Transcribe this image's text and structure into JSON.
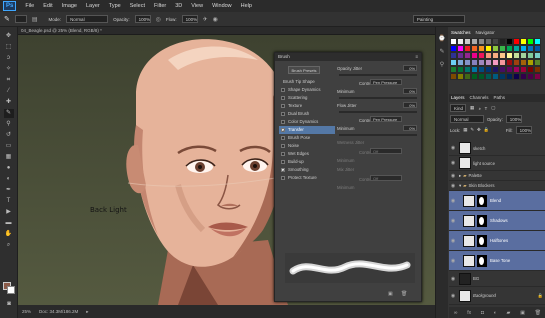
{
  "menubar": {
    "logo": "Ps",
    "items": [
      "File",
      "Edit",
      "Image",
      "Layer",
      "Type",
      "Select",
      "Filter",
      "3D",
      "View",
      "Window",
      "Help"
    ]
  },
  "options": {
    "mode_label": "Mode:",
    "mode_value": "Normal",
    "opacity_label": "Opacity:",
    "opacity_value": "100%",
    "flow_label": "Flow:",
    "flow_value": "100%",
    "workspace": "Painting"
  },
  "document": {
    "tab": "04_Beagle.psd @ 25% (Blend, RGB/8) *",
    "canvas_text": "Back Light",
    "zoom": "25%",
    "doc_info": "Doc: 34.3M/186.2M"
  },
  "brush_panel": {
    "tab": "Brush",
    "presets_button": "Brush Presets",
    "opacity_jitter_label": "Opacity Jitter",
    "opacity_jitter_value": "0%",
    "control_label": "Control:",
    "control_value": "Pen Pressure",
    "minimum_label": "Minimum",
    "minimum_value": "0%",
    "flow_jitter_label": "Flow Jitter",
    "flow_jitter_value": "0%",
    "control2_label": "Control:",
    "control2_value": "Pen Pressure",
    "minimum2_label": "Minimum",
    "minimum2_value": "0%",
    "wetness_label": "Wetness Jitter",
    "control3_label": "Control:",
    "control3_value": "Off",
    "minimum3_label": "Minimum",
    "mix_label": "Mix Jitter",
    "control4_label": "Control:",
    "control4_value": "Off",
    "minimum4_label": "Minimum",
    "items": [
      {
        "label": "Brush Tip Shape",
        "checked": false,
        "header": true
      },
      {
        "label": "Shape Dynamics",
        "checked": false
      },
      {
        "label": "Scattering",
        "checked": false
      },
      {
        "label": "Texture",
        "checked": false
      },
      {
        "label": "Dual Brush",
        "checked": false
      },
      {
        "label": "Color Dynamics",
        "checked": false
      },
      {
        "label": "Transfer",
        "checked": true,
        "selected": true
      },
      {
        "label": "Brush Pose",
        "checked": false
      },
      {
        "label": "Noise",
        "checked": false
      },
      {
        "label": "Wet Edges",
        "checked": false
      },
      {
        "label": "Build-up",
        "checked": false
      },
      {
        "label": "Smoothing",
        "checked": true
      },
      {
        "label": "Protect Texture",
        "checked": false
      }
    ]
  },
  "swatches_panel": {
    "tabs": [
      "Swatches",
      "Navigator"
    ],
    "colors": [
      "#ffffff",
      "#eeeeee",
      "#cccccc",
      "#aaaaaa",
      "#888888",
      "#666666",
      "#444444",
      "#222222",
      "#000000",
      "#ff0000",
      "#ffff00",
      "#00ff00",
      "#00ffff",
      "#0000ff",
      "#ff00ff",
      "#ee1c24",
      "#f26522",
      "#f7941d",
      "#fff200",
      "#8dc63f",
      "#39b54a",
      "#00a651",
      "#00a99d",
      "#00aeef",
      "#0072bc",
      "#0054a6",
      "#2e3192",
      "#662d91",
      "#92278f",
      "#ec008c",
      "#ed145b",
      "#f69679",
      "#f9ad81",
      "#fdc689",
      "#fff799",
      "#c4df9b",
      "#a3d39c",
      "#82ca9c",
      "#7accc8",
      "#6dcff6",
      "#7da7d9",
      "#8393ca",
      "#8781bd",
      "#a187be",
      "#bd8cbf",
      "#f49ac1",
      "#f5989d",
      "#9e0b0f",
      "#a0410d",
      "#a36209",
      "#aba000",
      "#598527",
      "#1a7b30",
      "#007236",
      "#00746b",
      "#0076a3",
      "#004b80",
      "#003471",
      "#1b1464",
      "#440e62",
      "#630460",
      "#9e005d",
      "#9e0039",
      "#790000",
      "#7b2e00",
      "#7d4900",
      "#827b00",
      "#406618",
      "#005e20",
      "#005826",
      "#005952",
      "#005b7f",
      "#003663",
      "#002157",
      "#0d004c",
      "#32004b",
      "#4b0049",
      "#7b0046"
    ]
  },
  "layers_panel": {
    "tabs": [
      "Layers",
      "Channels",
      "Paths"
    ],
    "kind_label": "Kind",
    "blend_mode": "Normal",
    "opacity_label": "Opacity:",
    "opacity_value": "100%",
    "lock_label": "Lock:",
    "fill_label": "Fill:",
    "fill_value": "100%",
    "layers": [
      {
        "name": "sketch",
        "type": "layer"
      },
      {
        "name": "light source",
        "type": "layer"
      },
      {
        "name": "Palette",
        "type": "group"
      },
      {
        "name": "Skin Blockers",
        "type": "group"
      },
      {
        "name": "Blend",
        "type": "masked",
        "selected": true
      },
      {
        "name": "Shadows",
        "type": "masked",
        "selected": true
      },
      {
        "name": "Halftones",
        "type": "masked",
        "selected": true
      },
      {
        "name": "Base Tone",
        "type": "masked",
        "selected": true
      },
      {
        "name": "BG",
        "type": "dark"
      },
      {
        "name": "Background",
        "type": "layer"
      }
    ]
  }
}
